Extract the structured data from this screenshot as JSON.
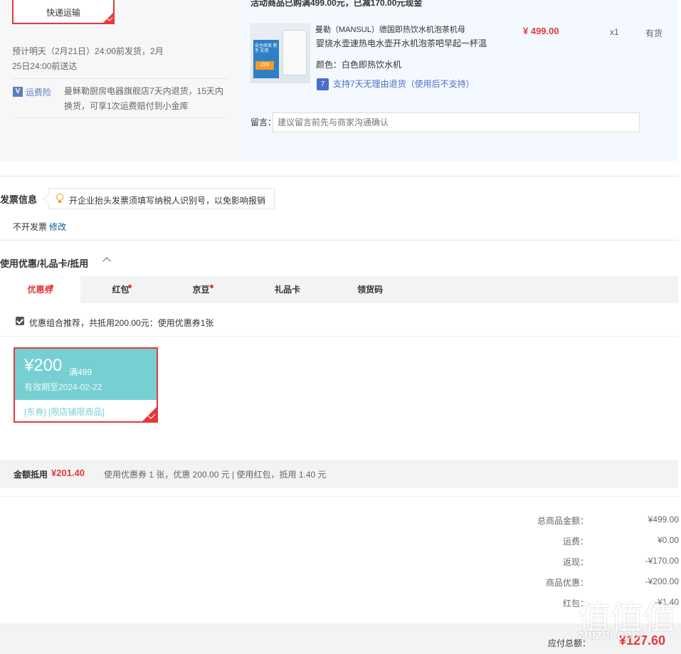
{
  "shipping": {
    "method_label": "快递运输",
    "eta": "预计明天（2月21日）24:00前发货，2月25日24:00前送达",
    "insurance_icon": "V",
    "insurance_label": "运费险",
    "insurance_text": "曼稣勒厨房电器旗舰店7天内退货，15天内换货，可享1次运费赔付到小金库"
  },
  "product": {
    "promo_header": "活动商品已购满499.00元，已减170.00元现金",
    "thumb_text": "自主研发 新手 实用",
    "thumb_price": "229",
    "brand": "曼勒（MANSUL）德国即热饮水机泡茶机母",
    "name": "婴烧水壶速热电水壶开水机泡茶吧早起一杯温",
    "color_label": "颜色：",
    "color_value": "白色即热饮水机",
    "return_icon": "7",
    "return_text": "支持7天无理由退货（使用后不支持）",
    "price": "¥ 499.00",
    "qty": "x1",
    "stock": "有货"
  },
  "memo": {
    "label": "留言：",
    "placeholder": "建议留言前先与商家沟通确认"
  },
  "invoice": {
    "title": "发票信息",
    "tip": "开企业抬头发票须填写纳税人识别号，以免影响报销",
    "status": "不开发票",
    "edit": "修改"
  },
  "coupons": {
    "title": "使用优惠/礼品卡/抵用",
    "tabs": [
      {
        "label": "优惠券",
        "dot": true
      },
      {
        "label": "红包",
        "dot": true
      },
      {
        "label": "京豆",
        "dot": true
      },
      {
        "label": "礼品卡",
        "dot": false
      },
      {
        "label": "领货码",
        "dot": false
      }
    ],
    "recommend_text": "优惠组合推荐，共抵用200.00元：使用优惠券1张",
    "coupon": {
      "amount": "¥200",
      "condition": "满499",
      "validity": "有效期至2024-02-22",
      "tags": "[东券] [限店铺限商品]"
    }
  },
  "deduction": {
    "label": "金额抵用",
    "amount": "¥201.40",
    "detail": "使用优惠券 1 张，优惠 200.00 元  | 使用红包，抵用 1.40 元"
  },
  "totals": [
    {
      "label": "总商品金额：",
      "value": "¥499.00"
    },
    {
      "label": "运费：",
      "value": "¥0.00"
    },
    {
      "label": "返现：",
      "value": "-¥170.00"
    },
    {
      "label": "商品优惠：",
      "value": "-¥200.00"
    },
    {
      "label": "红包：",
      "value": "-¥1.40"
    }
  ],
  "payable": {
    "label": "应付总额：",
    "amount": "¥127.60"
  },
  "watermark": {
    "glyphs": "值值值",
    "site": "zhizhi.com"
  },
  "colors": {
    "accent": "#e4393c",
    "coupon": "#76cfd3",
    "link": "#005ea7"
  }
}
